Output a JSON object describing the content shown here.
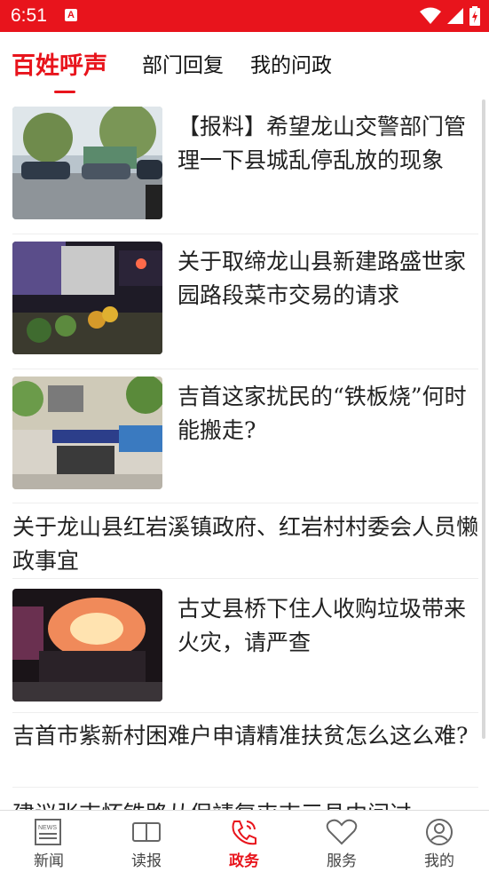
{
  "status_bar": {
    "time": "6:51",
    "notification_icon": "a-notification-icon",
    "icons": [
      "wifi-icon",
      "cell-signal-icon",
      "battery-charging-icon"
    ]
  },
  "tabs": [
    {
      "label": "百姓呼声",
      "active": true
    },
    {
      "label": "部门回复",
      "active": false
    },
    {
      "label": "我的问政",
      "active": false
    }
  ],
  "feed": [
    {
      "title": "【报料】希望龙山交警部门管理一下县城乱停乱放的现象",
      "thumbnail": "street-parked-cars-photo"
    },
    {
      "title": "关于取缔龙山县新建路盛世家园路段菜市交易的请求",
      "thumbnail": "night-vegetable-market-photo"
    },
    {
      "title": "吉首这家扰民的“铁板烧”何时能搬走?",
      "thumbnail": "storefront-street-photo"
    },
    {
      "title": "关于龙山县红岩溪镇政府、红岩村村委会人员懒政事宜"
    },
    {
      "title": "古丈县桥下住人收购垃圾带来火灾，请严查",
      "thumbnail": "night-fire-crowd-photo"
    },
    {
      "title": "吉首市紫新村困难户申请精准扶贫怎么这么难?"
    },
    {
      "title": "建议张吉怀铁路从保靖复屯吉三县中间过"
    }
  ],
  "bottom_nav": [
    {
      "label": "新闻",
      "icon": "newspaper-icon",
      "active": false
    },
    {
      "label": "读报",
      "icon": "reader-icon",
      "active": false
    },
    {
      "label": "政务",
      "icon": "phone-icon",
      "active": true
    },
    {
      "label": "服务",
      "icon": "heart-icon",
      "active": false
    },
    {
      "label": "我的",
      "icon": "user-icon",
      "active": false
    }
  ],
  "colors": {
    "accent": "#e8141c",
    "text": "#222222",
    "divider": "#eeeeee"
  }
}
